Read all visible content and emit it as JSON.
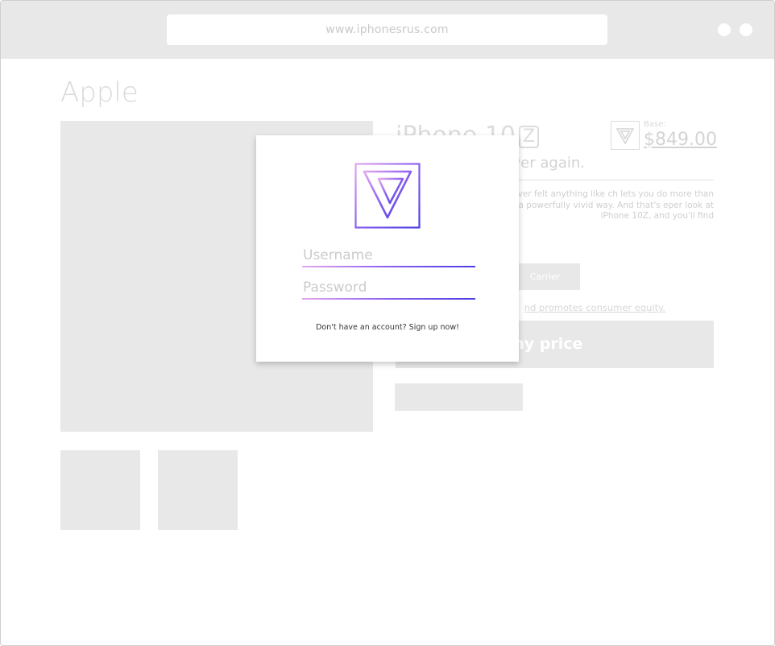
{
  "browser": {
    "url": "www.iphonesrus.com"
  },
  "page": {
    "brand": "Apple",
    "product_title": "iPhone 10",
    "product_badge": "Z",
    "tagline": "ver again.",
    "price_label": "Base:",
    "price": "$849.00",
    "description": "10Z, you know you've never felt anything like ch lets you do more than ever before. Live to life in a powerfully vivid way. And that's eper look at iPhone 10Z, and you'll find",
    "carrier_label": "Carrier",
    "equity_link": "nd promotes consumer equity.",
    "price_button": "my price"
  },
  "login": {
    "username_placeholder": "Username",
    "password_placeholder": "Password",
    "signup_text": "Don't have an account? Sign up now!"
  },
  "colors": {
    "accent_start": "#e4a8ec",
    "accent_mid": "#8a5ff0",
    "accent_end": "#4a3fe2"
  }
}
